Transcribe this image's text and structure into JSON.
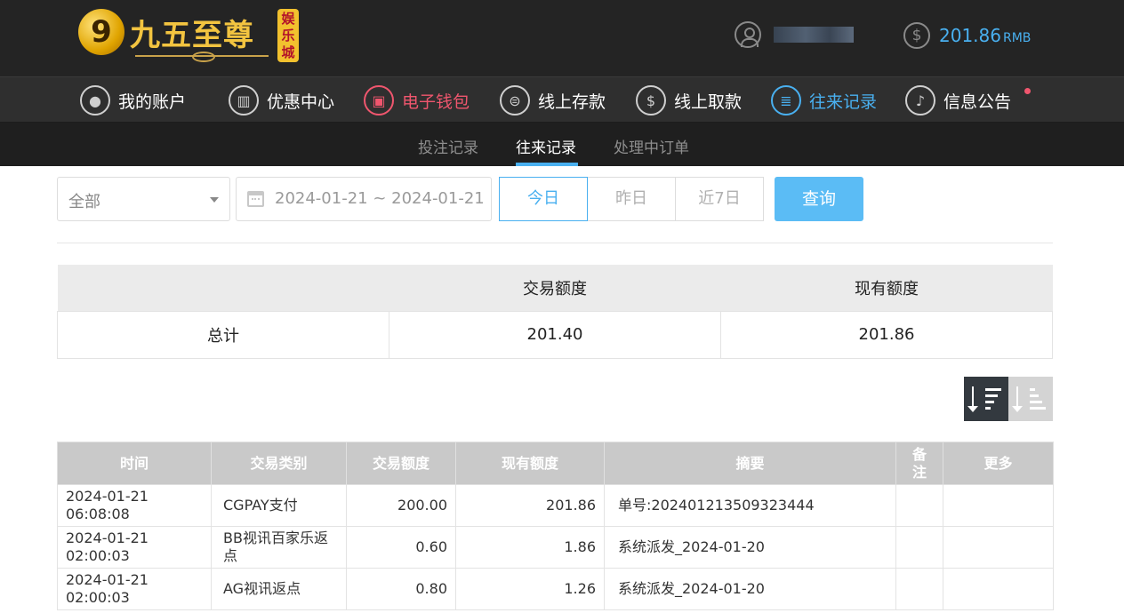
{
  "header": {
    "logo_mark": "9",
    "logo_name": "九五至尊",
    "logo_tag": "娱乐城",
    "balance": {
      "icon": "dollar-circle-icon",
      "amount": "201.86",
      "currency": "RMB"
    },
    "user_icon": "user-circle-icon"
  },
  "nav": {
    "items": [
      {
        "label": "我的账户",
        "icon": "user-icon"
      },
      {
        "label": "优惠中心",
        "icon": "gift-icon"
      },
      {
        "label": "电子钱包",
        "icon": "wallet-icon"
      },
      {
        "label": "线上存款",
        "icon": "deposit-icon"
      },
      {
        "label": "线上取款",
        "icon": "withdraw-icon"
      },
      {
        "label": "往来记录",
        "icon": "records-icon"
      },
      {
        "label": "信息公告",
        "icon": "bell-icon"
      }
    ],
    "colors": {
      "normal": "#ffffff",
      "wallet": "#f0566e",
      "active": "#49b0f0"
    }
  },
  "subnav": {
    "items": [
      {
        "label": "投注记录"
      },
      {
        "label": "往来记录"
      },
      {
        "label": "处理中订单"
      }
    ]
  },
  "filters": {
    "category": "全部",
    "date_range": "2024-01-21 ~ 2024-01-21",
    "quick_ranges": [
      "今日",
      "昨日",
      "近7日"
    ],
    "query_label": "查询"
  },
  "summary": {
    "headers": [
      "",
      "交易额度",
      "现有额度"
    ],
    "row": {
      "label": "总计",
      "transaction": "201.40",
      "current": "201.86"
    }
  },
  "records": {
    "headers": [
      "时间",
      "交易类别",
      "交易额度",
      "现有额度",
      "摘要",
      "备注",
      "更多"
    ],
    "rows": [
      {
        "time": "2024-01-21 06:08:08",
        "type": "CGPAY支付",
        "amount": "200.00",
        "balance": "201.86",
        "summary": "单号:202401213509323444",
        "note": "",
        "more": ""
      },
      {
        "time": "2024-01-21 02:00:03",
        "type": "BB视讯百家乐返点",
        "amount": "0.60",
        "balance": "1.86",
        "summary": "系统派发_2024-01-20",
        "note": "",
        "more": ""
      },
      {
        "time": "2024-01-21 02:00:03",
        "type": "AG视讯返点",
        "amount": "0.80",
        "balance": "1.26",
        "summary": "系统派发_2024-01-20",
        "note": "",
        "more": ""
      }
    ]
  }
}
